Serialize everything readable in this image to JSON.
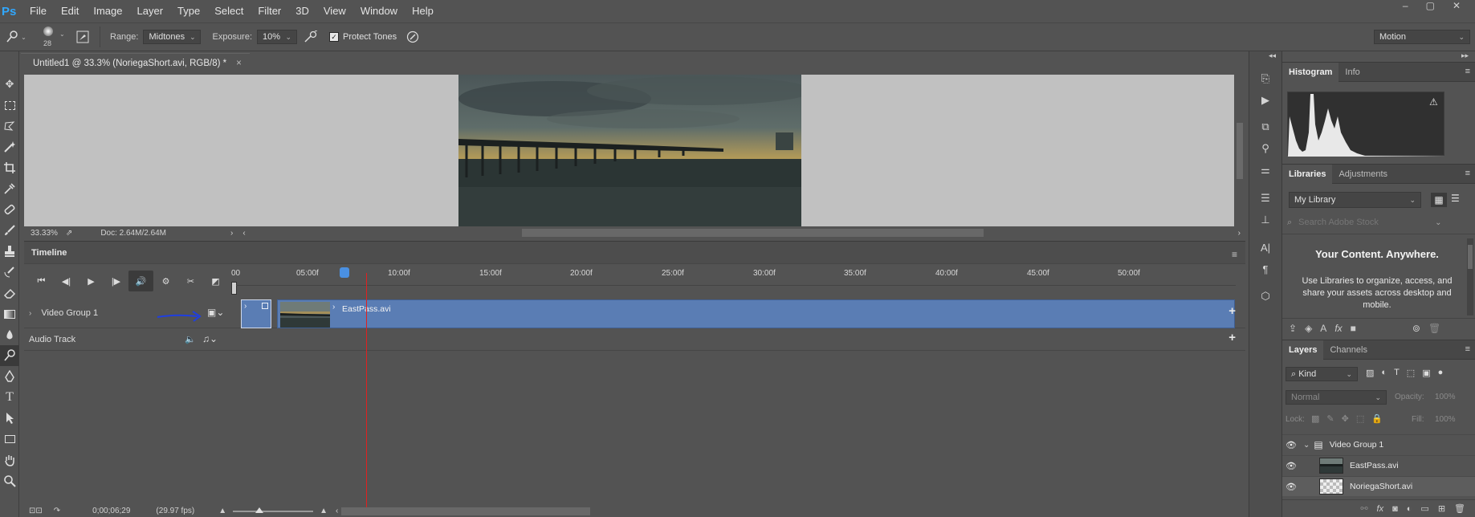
{
  "app": {
    "logo": "Ps"
  },
  "menu": [
    "File",
    "Edit",
    "Image",
    "Layer",
    "Type",
    "Select",
    "Filter",
    "3D",
    "View",
    "Window",
    "Help"
  ],
  "window_controls": {
    "minimize": "–",
    "restore": "▢",
    "close": "✕"
  },
  "options": {
    "brush_size": "28",
    "range_label": "Range:",
    "range_value": "Midtones",
    "exposure_label": "Exposure:",
    "exposure_value": "10%",
    "protect_tones_label": "Protect Tones",
    "protect_tones_checked": true,
    "workspace": "Motion"
  },
  "document": {
    "tab_title": "Untitled1 @ 33.3% (NoriegaShort.avi, RGB/8) *",
    "tab_close": "×",
    "zoom": "33.33%",
    "doc_size": "Doc: 2.64M/2.64M"
  },
  "timeline": {
    "title": "Timeline",
    "ruler_labels": [
      "00",
      "05:00f",
      "10:00f",
      "15:00f",
      "20:00f",
      "25:00f",
      "30:00f",
      "35:00f",
      "40:00f",
      "45:00f",
      "50:00f"
    ],
    "video_group": "Video Group 1",
    "clip_name": "EastPass.avi",
    "audio_track": "Audio Track",
    "current_time": "0;00;06;29",
    "fps": "(29.97 fps)"
  },
  "panels": {
    "histogram_tabs": [
      "Histogram",
      "Info"
    ],
    "libraries_tabs": [
      "Libraries",
      "Adjustments"
    ],
    "library_name": "My Library",
    "search_placeholder": "Search Adobe Stock",
    "lib_heading": "Your Content. Anywhere.",
    "lib_body": "Use Libraries to organize, access, and share your assets across desktop and mobile.",
    "layers_tabs": [
      "Layers",
      "Channels"
    ],
    "kind_label": "Kind",
    "blend_mode": "Normal",
    "opacity_label": "Opacity:",
    "opacity_value": "100%",
    "lock_label": "Lock:",
    "fill_label": "Fill:",
    "fill_value": "100%"
  },
  "layers": [
    {
      "name": "Video Group 1",
      "type": "group"
    },
    {
      "name": "EastPass.avi",
      "type": "video"
    },
    {
      "name": "NoriegaShort.avi",
      "type": "video",
      "selected": true
    }
  ],
  "colors": {
    "panel_bg": "#535353",
    "clip_blue": "#5a7db4",
    "playhead_red": "#e02020",
    "brand": "#31a8ff"
  }
}
